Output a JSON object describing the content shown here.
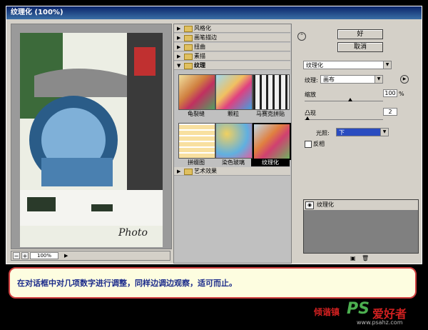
{
  "window": {
    "title": "纹理化 (100%)"
  },
  "preview": {
    "zoom": "100%",
    "minus": "−",
    "plus": "+",
    "caption": "Photo"
  },
  "filters": {
    "categories": [
      "风格化",
      "画笔描边",
      "扭曲",
      "素描",
      "纹理",
      "艺术效果"
    ],
    "open_category": "纹理",
    "thumbs": [
      "龟裂缝",
      "颗粒",
      "马赛克拼贴",
      "拼缀图",
      "染色玻璃",
      "纹理化"
    ],
    "selected": "纹理化"
  },
  "buttons": {
    "ok": "好",
    "cancel": "取消"
  },
  "settings": {
    "filter_select": "纹理化",
    "texture_label": "纹理:",
    "texture_value": "画布",
    "scale_label": "缩放",
    "scale_value": "100",
    "scale_unit": "%",
    "scale_level": 0.58,
    "relief_label": "凸现",
    "relief_value": "2",
    "relief_level": 0.04,
    "light_label": "光照:",
    "light_value": "下",
    "invert_label": "反相"
  },
  "layers": {
    "name": "纹理化"
  },
  "note": "在对话框中对几项数字进行调整，同样边调边观察，适可而止。",
  "watermark": {
    "left": "倾谐镇",
    "ps": "PS",
    "brand": "爱好者",
    "url": "www.psahz.com"
  },
  "colors": {
    "title": "#0a246a",
    "note_border": "#d04040",
    "note_text": "#1a2a8a",
    "light_select": "#2a4cc0"
  }
}
